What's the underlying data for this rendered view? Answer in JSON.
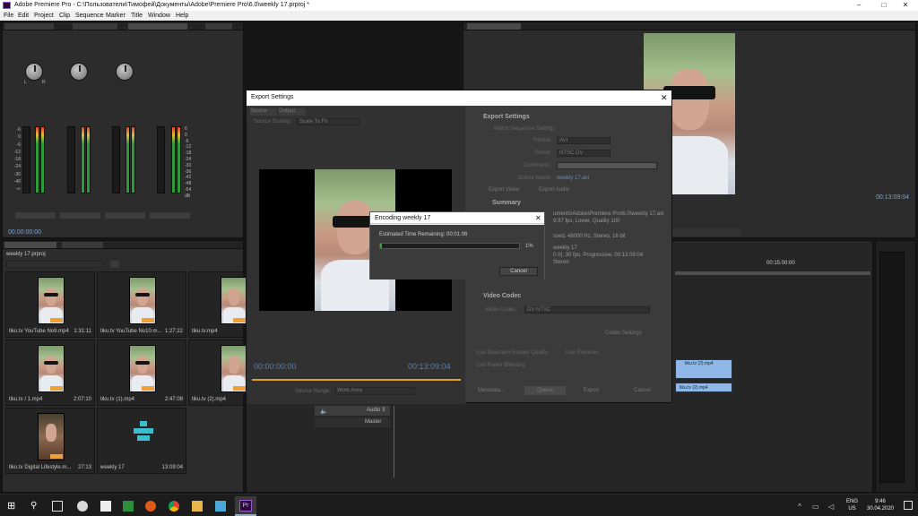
{
  "window": {
    "title": "Adobe Premiere Pro - C:\\Пользователи\\Тимофей\\Документы\\Adobe\\Premiere Pro\\6.0\\weekly 17.prproj *",
    "minimize": "–",
    "maximize": "□",
    "close": "✕"
  },
  "menu": [
    "File",
    "Edit",
    "Project",
    "Clip",
    "Sequence",
    "Marker",
    "Title",
    "Window",
    "Help"
  ],
  "mixer": {
    "knob_labels": [
      "L",
      "R"
    ],
    "scale": [
      "-6",
      "0",
      "-6",
      "-12",
      "-18",
      "-24",
      "-30",
      "-40",
      "-∞"
    ],
    "db_scale": [
      "6",
      "0",
      "-6",
      "-12",
      "-18",
      "-24",
      "-30",
      "-36",
      "-42",
      "-48",
      "-54",
      "dB"
    ],
    "timecode": "00:00:00:00"
  },
  "program_monitor": {
    "timecode": "00:13:09:04"
  },
  "project": {
    "file": "weekly 17.prproj",
    "items": [
      {
        "name": "tiku.tv YouTube No9.mp4",
        "duration": "1:31:11"
      },
      {
        "name": "tiku.tv YouTube No10.m...",
        "duration": "1:27:22"
      },
      {
        "name": "tiku.tv.mp4",
        "duration": ""
      },
      {
        "name": "tiku.tv / 1.mp4",
        "duration": "2:07:10"
      },
      {
        "name": "tiku.tv (1).mp4",
        "duration": "2:47:09"
      },
      {
        "name": "tiku.tv (2).mp4",
        "duration": ""
      },
      {
        "name": "tiku.tv Digital Lifestyle.m...",
        "duration": "27:13"
      },
      {
        "name": "weekly 17",
        "duration": "13:09:04"
      }
    ]
  },
  "export_dialog": {
    "title": "Export Settings",
    "close": "✕",
    "tab_source": "Source",
    "tab_output": "Output",
    "source_scaling_label": "Source Scaling:",
    "source_scaling_value": "Scale To Fit",
    "timecode_start": "00:00:00:00",
    "timecode_end": "00:13:09:04",
    "source_range_label": "Source Range:",
    "source_range_value": "Work Area",
    "export_settings_heading": "Export Settings",
    "match_sequence": "Match Sequence Settings",
    "format_label": "Format:",
    "format_value": "AVI",
    "preset_label": "Preset:",
    "preset_value": "NTSC DV",
    "comments_label": "Comments:",
    "output_name_label": "Output Name:",
    "output_name_value": "weekly 17.avi",
    "export_video": "Export Video",
    "export_audio": "Export Audio",
    "summary_heading": "Summary",
    "summary_line1": "uments\\Adobe\\Premiere Pro\\6.0\\weekly 17.avi",
    "summary_line2": "9.97 fps, Lower, Quality 100",
    "summary_line3": "ssed, 48000 Hz, Stereo, 16 bit",
    "summary_line4": "weekly 17",
    "summary_line5": "0.0), 30 fps, Progressive, 00:13:09:04",
    "summary_line6": "Stereo",
    "video_codec_heading": "Video Codec",
    "video_codec_label": "Video Codec:",
    "video_codec_value": "DV NTSC",
    "codec_settings": "Codec Settings",
    "max_render": "Use Maximum Render Quality",
    "use_previews": "Use Previews",
    "frame_blending": "Use Frame Blending",
    "metadata_btn": "Metadata...",
    "queue_btn": "Queue",
    "export_btn": "Export",
    "cancel_btn": "Cancel"
  },
  "encoding": {
    "title": "Encoding weekly 17",
    "close": "✕",
    "remaining_label": "Estimated Time Remaining: 00:01:06",
    "progress": 0.01,
    "percent": "1%",
    "cancel": "Cancel"
  },
  "timeline": {
    "ruler_label": "00:15:00:00",
    "clip1": "tiku.tv (2).mp4",
    "clip2": "tiku.tv (2).mp4",
    "clip3": "tiku",
    "clip4": "tiku.tv (2).mp4",
    "audio3": "Audio 3",
    "master": "Master"
  },
  "taskbar": {
    "lang1": "ENG",
    "lang2": "US",
    "time": "9:46",
    "date": "30.04.2020"
  },
  "colors": {
    "accent_orange": "#f0a030",
    "progress_green": "#3ea03e",
    "premiere_purple": "#9b59d0"
  }
}
